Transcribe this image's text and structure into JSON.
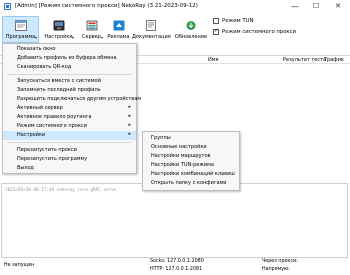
{
  "window": {
    "title": "[Admin] [Режим системного прокси] NekoRay (3.21-2023-09-12)",
    "minimize": "—",
    "maximize": "☐",
    "close": "✕"
  },
  "toolbar": {
    "buttons": [
      {
        "label": "Программа",
        "icon": "program-icon",
        "dropdown": "▾"
      },
      {
        "label": "Настройки",
        "icon": "settings-icon",
        "dropdown": "▾"
      },
      {
        "label": "Сервер",
        "icon": "server-icon",
        "dropdown": "▾"
      },
      {
        "label": "Реклама",
        "icon": "ad-icon",
        "dropdown": ""
      },
      {
        "label": "Документация",
        "icon": "docs-icon",
        "dropdown": ""
      },
      {
        "label": "Обновление",
        "icon": "update-icon",
        "dropdown": ""
      }
    ],
    "tun_mode": {
      "label": "Режим TUN",
      "checked": false
    },
    "system_proxy": {
      "label": "Режим системного прокси",
      "checked": true
    }
  },
  "table": {
    "columns": [
      "Имя",
      "Результат теста",
      "Трафик"
    ]
  },
  "log": {
    "line": "2023/09/20 08:17:49 sekoray_core gRPC serve"
  },
  "status": {
    "state": "Не запущен",
    "socks": "Socks: 127.0.0.1:2080",
    "http": "HTTP: 127.0.0.1:2081",
    "via_proxy": "Через прокси:",
    "direct": "Напрямую:"
  },
  "main_menu": {
    "items": [
      {
        "label": "Показать окно",
        "submenu": false
      },
      {
        "label": "Добавить профиль из буфера обмена",
        "submenu": false
      },
      {
        "label": "Сканировать QR-код",
        "submenu": false
      },
      {
        "sep": true
      },
      {
        "label": "Запускаться вместе с системой",
        "submenu": false
      },
      {
        "label": "Запомнить последний профиль",
        "submenu": false
      },
      {
        "label": "Разрешить подключаться другим устройствам",
        "submenu": false
      },
      {
        "label": "Активный сервер",
        "submenu": true
      },
      {
        "label": "Активное правило роутинга",
        "submenu": true
      },
      {
        "label": "Режим системного прокси",
        "submenu": true
      },
      {
        "label": "Настройки",
        "submenu": true,
        "highlight": true
      },
      {
        "sep": true
      },
      {
        "label": "Перезапустить прокси",
        "submenu": false
      },
      {
        "label": "Перезапустить программу",
        "submenu": false
      },
      {
        "label": "Выход",
        "submenu": false
      }
    ],
    "arrow": "▸"
  },
  "settings_submenu": {
    "items": [
      "Группы",
      "Основные настройки",
      "Настройки маршрутов",
      "Настройки TUN-режима",
      "Настройки комбинаций клавиш",
      "Открыть папку с конфигами"
    ]
  }
}
